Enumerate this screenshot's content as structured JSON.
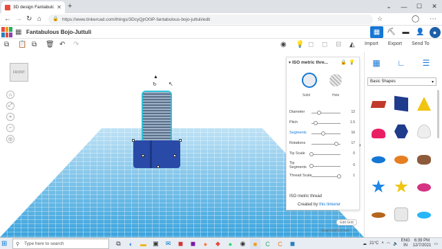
{
  "browser": {
    "tab_title": "3D design Fantabulous Bojo-Ju",
    "url": "https://www.tinkercad.com/things/3DcyQjrO0iP-fantabulous-bojo-juttuli/edit",
    "new_tab_icon": "+",
    "back_icon": "←",
    "forward_icon": "→",
    "reload_icon": "↻",
    "home_icon": "⌂",
    "star_icon": "☆",
    "menu_icon": "⋯"
  },
  "window": {
    "minimize": "—",
    "maximize": "☐",
    "close": "✕",
    "expand": "⌄"
  },
  "app": {
    "design_title": "Fantabulous Bojo-Juttuli",
    "header_icons": [
      "grid-view-icon",
      "pickaxe-icon",
      "briefcase-icon",
      "add-user-icon",
      "account-icon"
    ]
  },
  "toolbar": {
    "right_tabs": [
      "Import",
      "Export",
      "Send To"
    ]
  },
  "viewport": {
    "view_cube_label": "FRONT",
    "edit_grid_label": "Edit Grid",
    "snap_grid_label": "Snap Grid",
    "snap_grid_value": "1.0 mm"
  },
  "shape_panel": {
    "title": "ISO metric thre...",
    "solid_label": "Solid",
    "hole_label": "Hole",
    "params": [
      {
        "label": "Diameter",
        "value": "12",
        "level": 0.25
      },
      {
        "label": "Pitch",
        "value": "1.5",
        "level": 0.15
      },
      {
        "label": "Segments",
        "value": "16",
        "level": 0.4,
        "active": true
      },
      {
        "label": "Rotations",
        "value": "17",
        "level": 0.85
      },
      {
        "label": "Tip Scale",
        "value": "0",
        "level": 0.0
      },
      {
        "label": "Tip Segments",
        "value": "0",
        "level": 0.0
      },
      {
        "label": "Thread Scale",
        "value": "1",
        "level": 0.95
      }
    ],
    "footer_title": "ISO metric thread",
    "credit_prefix": "Created by",
    "credit_link": "this tinkerer"
  },
  "library": {
    "category": "Basic Shapes",
    "shapes": [
      "text-shape",
      "box",
      "pyramid",
      "half-sphere",
      "polygon",
      "paraboloid",
      "torus",
      "tube",
      "mountain",
      "star",
      "star",
      "torus",
      "ring",
      "box-rounded",
      "ellipsoid"
    ]
  },
  "taskbar": {
    "search_placeholder": "Type here to search",
    "temperature": "21°C",
    "lang": "ENG",
    "region": "IN",
    "time": "6:39 PM",
    "date": "12/7/2021"
  },
  "colors": {
    "accent": "#1477d4",
    "grid": "#4fb4e8",
    "bolt_head": "#2a4aa8",
    "selection": "#2fc3d8"
  }
}
